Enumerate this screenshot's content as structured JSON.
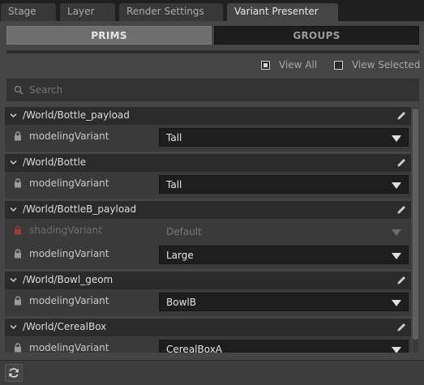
{
  "tabs": [
    {
      "label": "Stage",
      "active": false
    },
    {
      "label": "Layer",
      "active": false
    },
    {
      "label": "Render Settings",
      "active": false
    },
    {
      "label": "Variant Presenter",
      "active": true
    }
  ],
  "mode_toggle": {
    "prims_label": "PRIMS",
    "groups_label": "GROUPS",
    "selected": "PRIMS"
  },
  "view_options": {
    "view_all_label": "View All",
    "view_all_checked": true,
    "view_selected_label": "View Selected",
    "view_selected_checked": false
  },
  "search": {
    "placeholder": "Search",
    "value": ""
  },
  "prims": [
    {
      "path": "/World/Bottle_payload",
      "variants": [
        {
          "name": "modelingVariant",
          "value": "Tall",
          "enabled": true
        }
      ]
    },
    {
      "path": "/World/Bottle",
      "variants": [
        {
          "name": "modelingVariant",
          "value": "Tall",
          "enabled": true
        }
      ]
    },
    {
      "path": "/World/BottleB_payload",
      "variants": [
        {
          "name": "shadingVariant",
          "value": "Default",
          "enabled": false
        },
        {
          "name": "modelingVariant",
          "value": "Large",
          "enabled": true
        }
      ]
    },
    {
      "path": "/World/Bowl_geom",
      "variants": [
        {
          "name": "modelingVariant",
          "value": "BowlB",
          "enabled": true
        }
      ]
    },
    {
      "path": "/World/CerealBox",
      "variants": [
        {
          "name": "modelingVariant",
          "value": "CerealBoxA",
          "enabled": true
        }
      ]
    }
  ],
  "colors": {
    "accent_lock_disabled": "#a33a3a",
    "panel_bg": "#454545",
    "header_bg": "#2b2b2b"
  },
  "icons": {
    "refresh": "refresh-icon",
    "lock": "lock-icon",
    "edit": "pencil-icon",
    "expand": "chevron-down-icon",
    "search": "search-icon"
  }
}
